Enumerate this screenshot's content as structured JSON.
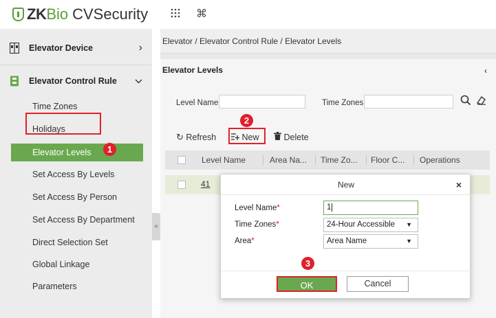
{
  "header": {
    "logo_zk": "ZK",
    "logo_bio": "Bio",
    "logo_cvs": "CVSecurity",
    "apps_icon": "apps-grid-icon",
    "cmd_icon": "command-icon"
  },
  "sidebar": {
    "groups": [
      {
        "label": "Elevator Device",
        "chevron": "›"
      },
      {
        "label": "Elevator Control Rule",
        "chevron": "⌄"
      }
    ],
    "items": [
      {
        "label": "Time Zones"
      },
      {
        "label": "Holidays"
      },
      {
        "label": "Elevator Levels",
        "active": true
      },
      {
        "label": "Set Access By Levels"
      },
      {
        "label": "Set Access By Person"
      },
      {
        "label": "Set Access By Department"
      },
      {
        "label": "Direct Selection Set"
      },
      {
        "label": "Global Linkage"
      },
      {
        "label": "Parameters"
      }
    ],
    "collapse_glyph": "«"
  },
  "main": {
    "breadcrumb": "Elevator / Elevator Control Rule / Elevator Levels",
    "panel_title": "Elevator Levels",
    "panel_collapse": "‹",
    "filters": {
      "level_name_label": "Level Name",
      "level_name_value": "",
      "time_zones_label": "Time Zones",
      "time_zones_value": ""
    },
    "toolbar": {
      "refresh": "Refresh",
      "new": "New",
      "delete": "Delete"
    },
    "grid": {
      "columns": [
        "Level Name",
        "Area Na...",
        "Time Zo...",
        "Floor C...",
        "Operations"
      ],
      "rows": [
        {
          "level_name": "41"
        }
      ]
    }
  },
  "dialog": {
    "title": "New",
    "close": "×",
    "fields": [
      {
        "label": "Level Name",
        "value": "1"
      },
      {
        "label": "Time Zones",
        "value": "24-Hour Accessible"
      },
      {
        "label": "Area",
        "value": "Area Name"
      }
    ],
    "required_mark": "*",
    "ok": "OK",
    "cancel": "Cancel"
  },
  "annotations": {
    "step1": "1",
    "step2": "2",
    "step3": "3"
  },
  "colors": {
    "accent_green": "#6aa84f",
    "annotation_red": "#e0202a"
  }
}
